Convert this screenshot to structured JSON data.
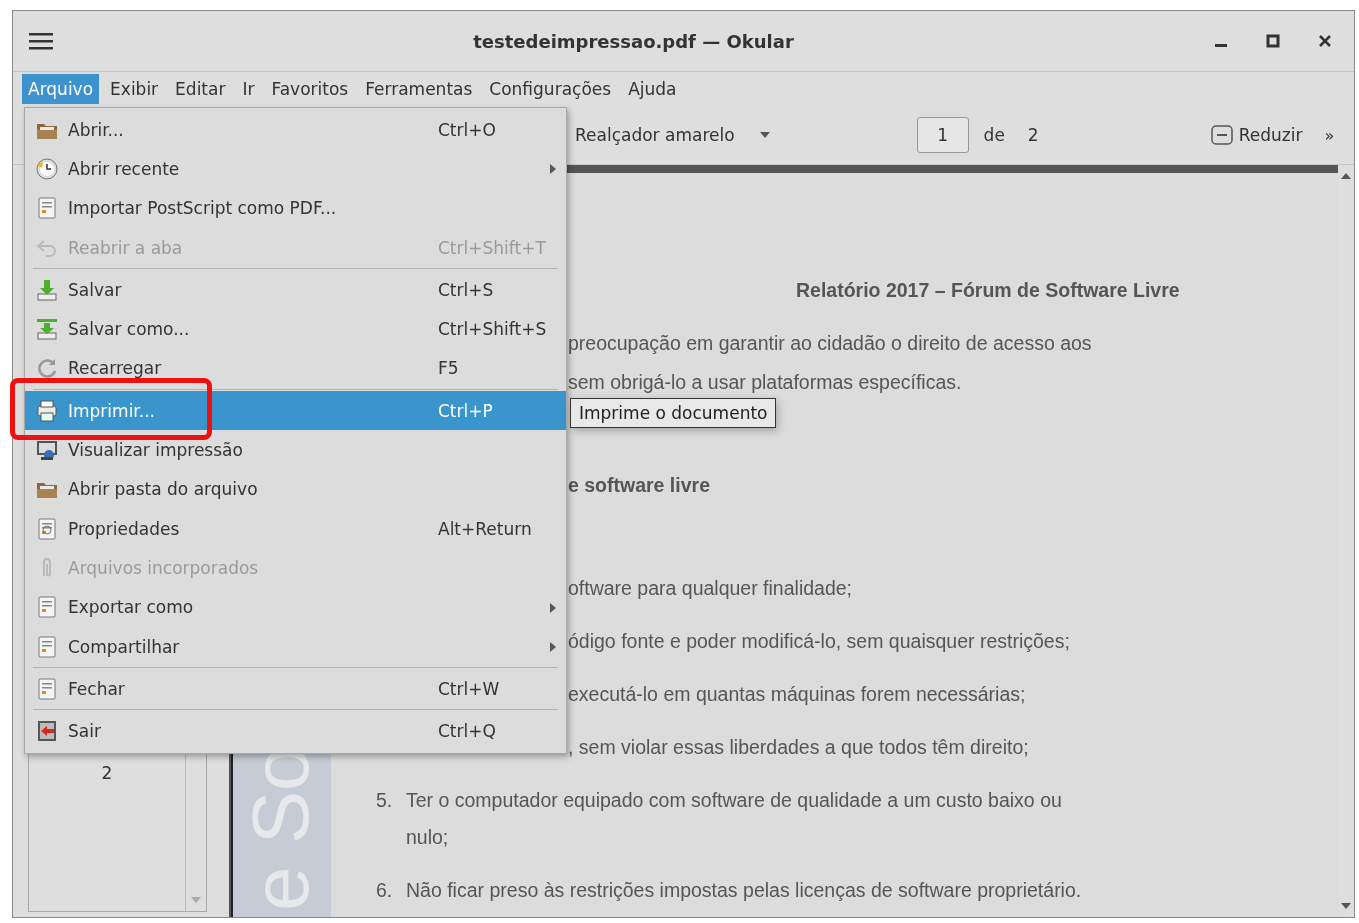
{
  "window": {
    "title": "testedeimpressao.pdf — Okular"
  },
  "menubar": [
    {
      "label": "Arquivo",
      "selected": true
    },
    {
      "label": "Exibir",
      "selected": false
    },
    {
      "label": "Editar",
      "selected": false
    },
    {
      "label": "Ir",
      "selected": false
    },
    {
      "label": "Favoritos",
      "selected": false
    },
    {
      "label": "Ferramentas",
      "selected": false
    },
    {
      "label": "Configurações",
      "selected": false
    },
    {
      "label": "Ajuda",
      "selected": false
    }
  ],
  "toolbar": {
    "annotation_tool": "Realçador amarelo",
    "page": "1",
    "page_of": "de",
    "page_count": "2",
    "zoom_out": "Reduzir",
    "overflow": "»"
  },
  "sidebar": {
    "thumbnail_label": "2"
  },
  "document": {
    "side_banner": "e So",
    "lines": [
      {
        "kind": "title",
        "text": "Relatório 2017 – Fórum de Software Livre"
      },
      {
        "kind": "cut",
        "text": "preocupação em garantir ao cidadão o direito de acesso aos"
      },
      {
        "kind": "cut",
        "text": "sem obrigá-lo a usar plataformas específicas."
      },
      {
        "kind": "heading",
        "text": "e software livre"
      },
      {
        "kind": "list-cut",
        "text": "oftware para qualquer finalidade;"
      },
      {
        "kind": "list-cut",
        "text": "ódigo fonte e poder modificá-lo, sem quaisquer restrições;"
      },
      {
        "kind": "list-cut",
        "text": "executá-lo em quantas máquinas forem necessárias;"
      },
      {
        "kind": "list-cut",
        "text": ", sem violar essas liberdades a que todos têm direito;"
      },
      {
        "kind": "list",
        "number": "5.",
        "text": "Ter o computador equipado com software de qualidade a um custo baixo ou"
      },
      {
        "kind": "cont",
        "text": "nulo;"
      },
      {
        "kind": "list",
        "number": "6.",
        "text": "Não ficar preso às restrições impostas pelas licenças de software proprietário."
      }
    ]
  },
  "file_menu": [
    {
      "kind": "item",
      "label": "Abrir...",
      "shortcut": "Ctrl+O",
      "disabled": false,
      "submenu": false,
      "selected": false
    },
    {
      "kind": "item",
      "label": "Abrir recente",
      "disabled": false,
      "submenu": true,
      "selected": false
    },
    {
      "kind": "item",
      "label": "Importar PostScript como PDF...",
      "disabled": false,
      "submenu": false,
      "selected": false
    },
    {
      "kind": "item",
      "label": "Reabrir a aba",
      "shortcut": "Ctrl+Shift+T",
      "disabled": true,
      "submenu": false,
      "selected": false
    },
    {
      "kind": "separator"
    },
    {
      "kind": "item",
      "label": "Salvar",
      "shortcut": "Ctrl+S",
      "disabled": false,
      "submenu": false,
      "selected": false
    },
    {
      "kind": "item",
      "label": "Salvar como...",
      "shortcut": "Ctrl+Shift+S",
      "disabled": false,
      "submenu": false,
      "selected": false
    },
    {
      "kind": "item",
      "label": "Recarregar",
      "shortcut": "F5",
      "disabled": false,
      "submenu": false,
      "selected": false
    },
    {
      "kind": "separator"
    },
    {
      "kind": "item",
      "label": "Imprimir...",
      "shortcut": "Ctrl+P",
      "disabled": false,
      "submenu": false,
      "selected": true
    },
    {
      "kind": "item",
      "label": "Visualizar impressão",
      "disabled": false,
      "submenu": false,
      "selected": false
    },
    {
      "kind": "item",
      "label": "Abrir pasta do arquivo",
      "disabled": false,
      "submenu": false,
      "selected": false
    },
    {
      "kind": "item",
      "label": "Propriedades",
      "shortcut": "Alt+Return",
      "disabled": false,
      "submenu": false,
      "selected": false
    },
    {
      "kind": "item",
      "label": "Arquivos incorporados",
      "disabled": true,
      "submenu": false,
      "selected": false
    },
    {
      "kind": "item",
      "label": "Exportar como",
      "disabled": false,
      "submenu": true,
      "selected": false
    },
    {
      "kind": "item",
      "label": "Compartilhar",
      "disabled": false,
      "submenu": true,
      "selected": false
    },
    {
      "kind": "separator"
    },
    {
      "kind": "item",
      "label": "Fechar",
      "shortcut": "Ctrl+W",
      "disabled": false,
      "submenu": false,
      "selected": false
    },
    {
      "kind": "separator"
    },
    {
      "kind": "item",
      "label": "Sair",
      "shortcut": "Ctrl+Q",
      "disabled": false,
      "submenu": false,
      "selected": false
    }
  ],
  "tooltip": "Imprime o documento"
}
